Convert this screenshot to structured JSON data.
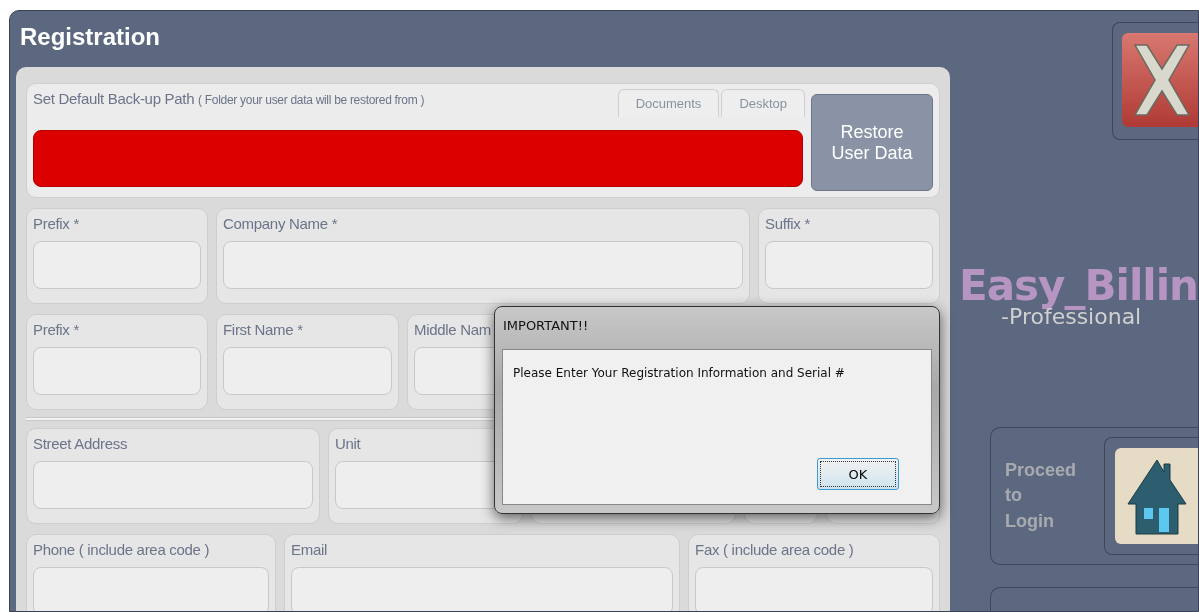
{
  "window": {
    "title": "Registration"
  },
  "backup": {
    "label": "Set Default Back-up Path",
    "hint": "( Folder your user data will be restored from )",
    "tabs": [
      {
        "label": "Documents",
        "selected": false
      },
      {
        "label": "Desktop",
        "selected": false
      }
    ],
    "path_invalid": true,
    "restore_button": "Restore User Data"
  },
  "rows": [
    [
      {
        "label": "Prefix *"
      },
      {
        "label": "Company Name *"
      },
      {
        "label": "Suffix *"
      }
    ],
    [
      {
        "label": "Prefix *"
      },
      {
        "label": "First Name *"
      },
      {
        "label": "Middle Nam"
      },
      {}
    ],
    [
      {
        "label": "Street Address"
      },
      {
        "label": "Unit"
      },
      {},
      {},
      {}
    ],
    [
      {
        "label": "Phone ( include area code )"
      },
      {
        "label": "Email"
      },
      {
        "label": "Fax ( include area code )"
      }
    ]
  ],
  "dialog": {
    "title": "IMPORTANT!!",
    "message": "Please Enter Your Registration Information and Serial #",
    "button": "OK"
  },
  "sidebar": {
    "logo_name": "Easy_Billin",
    "logo_tagline": "-Professional",
    "login_label": "Proceed to Login"
  }
}
